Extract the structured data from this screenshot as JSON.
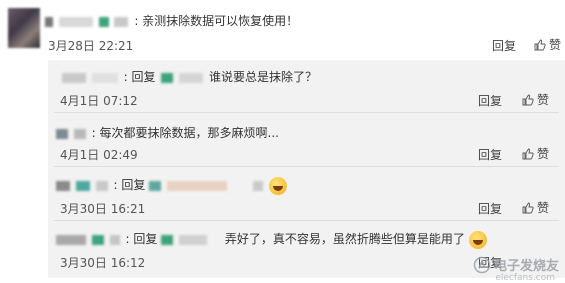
{
  "main_comment": {
    "text": ": 亲测抹除数据可以恢复使用！",
    "timestamp": "3月28日 22:21",
    "reply_label": "回复",
    "like_label": "赞"
  },
  "replies": [
    {
      "prefix": ": 回复",
      "text": "谁说要总是抹除了？",
      "timestamp": "4月1日 07:12",
      "reply_label": "回复",
      "like_label": "赞"
    },
    {
      "prefix": ": 每次都要抹除数据，那多麻烦啊...",
      "text": "",
      "timestamp": "4月1日 02:49",
      "reply_label": "回复",
      "like_label": "赞"
    },
    {
      "prefix": ": 回复",
      "text": "",
      "timestamp": "3月30日 16:21",
      "reply_label": "回复",
      "like_label": "赞"
    },
    {
      "prefix": ": 回复",
      "text": "弄好了，真不容易，虽然折腾些但算是能用了",
      "timestamp": "3月30日 16:12",
      "reply_label": "回复",
      "like_label": "赞"
    }
  ],
  "watermark": {
    "text": "电子发烧友",
    "sub": "elecfans.com"
  },
  "colors": {
    "reply_bg": "#f2f2f2",
    "blur_green": "#3ea37a",
    "blur_teal": "#5fa8a0"
  }
}
